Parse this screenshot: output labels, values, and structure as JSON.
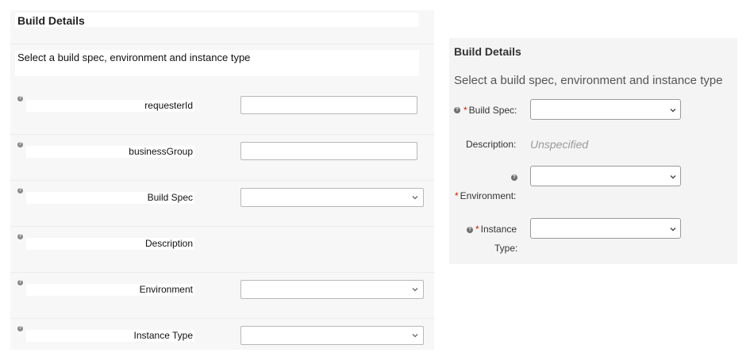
{
  "left_form": {
    "title": "Build Details",
    "description": "Select a build spec, environment and instance type",
    "help_glyph": "?",
    "fields": [
      {
        "label": "requesterId",
        "control": "text",
        "icon": "help-icon"
      },
      {
        "label": "businessGroup",
        "control": "text",
        "icon": "help-icon"
      },
      {
        "label": "Build Spec",
        "control": "select",
        "icon": "help-icon"
      },
      {
        "label": "Description",
        "control": "none",
        "icon": "help-icon"
      },
      {
        "label": "Environment",
        "control": "select",
        "icon": "help-icon"
      },
      {
        "label": "Instance Type",
        "control": "select",
        "icon": "help-icon"
      }
    ]
  },
  "right_form": {
    "title": "Build Details",
    "subtitle": "Select a build spec, environment and instance type",
    "required_marker": "*",
    "help_glyph": "?",
    "build_spec_label": "Build Spec:",
    "description_label": "Description:",
    "description_value": "Unspecified",
    "environment_label": "Environment:",
    "instance_type_label_line1": "Instance",
    "instance_type_label_line2": "Type:"
  },
  "colors": {
    "required": "#c92100",
    "panel_bg": "#f7f7f7",
    "input_border": "#b8b8b8"
  }
}
